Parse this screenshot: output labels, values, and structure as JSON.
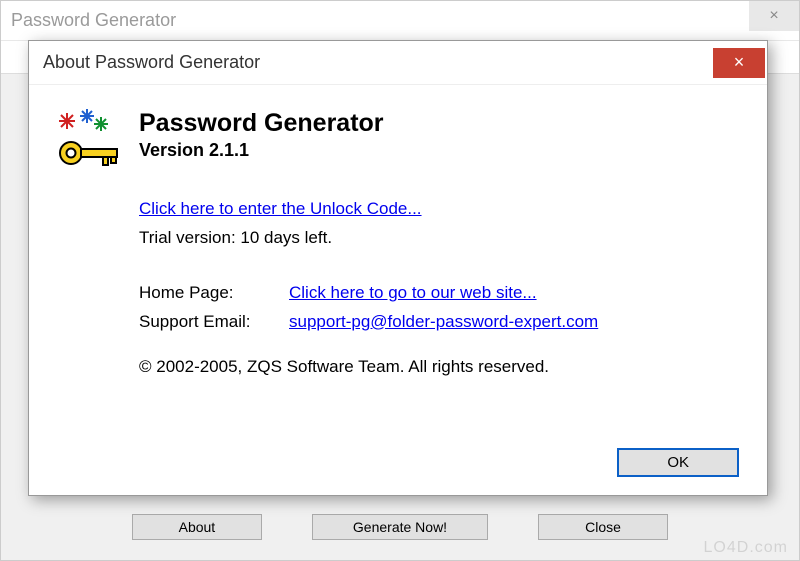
{
  "parent": {
    "title": "Password Generator",
    "close_label": "×",
    "buttons": {
      "about": "About",
      "generate": "Generate Now!",
      "close": "Close"
    }
  },
  "about": {
    "title": "About Password Generator",
    "close_label": "×",
    "app_name": "Password Generator",
    "version_label": "Version 2.1.1",
    "unlock_link": "Click here to enter the Unlock Code...",
    "trial_text": "Trial version: 10 days left.",
    "homepage_label": "Home Page:",
    "homepage_link": "Click here to go to our web site...",
    "support_label": "Support Email:",
    "support_link": "support-pg@folder-password-expert.com",
    "copyright": "© 2002-2005, ZQS Software Team. All rights reserved.",
    "ok_label": "OK"
  },
  "watermark": "LO4D.com"
}
